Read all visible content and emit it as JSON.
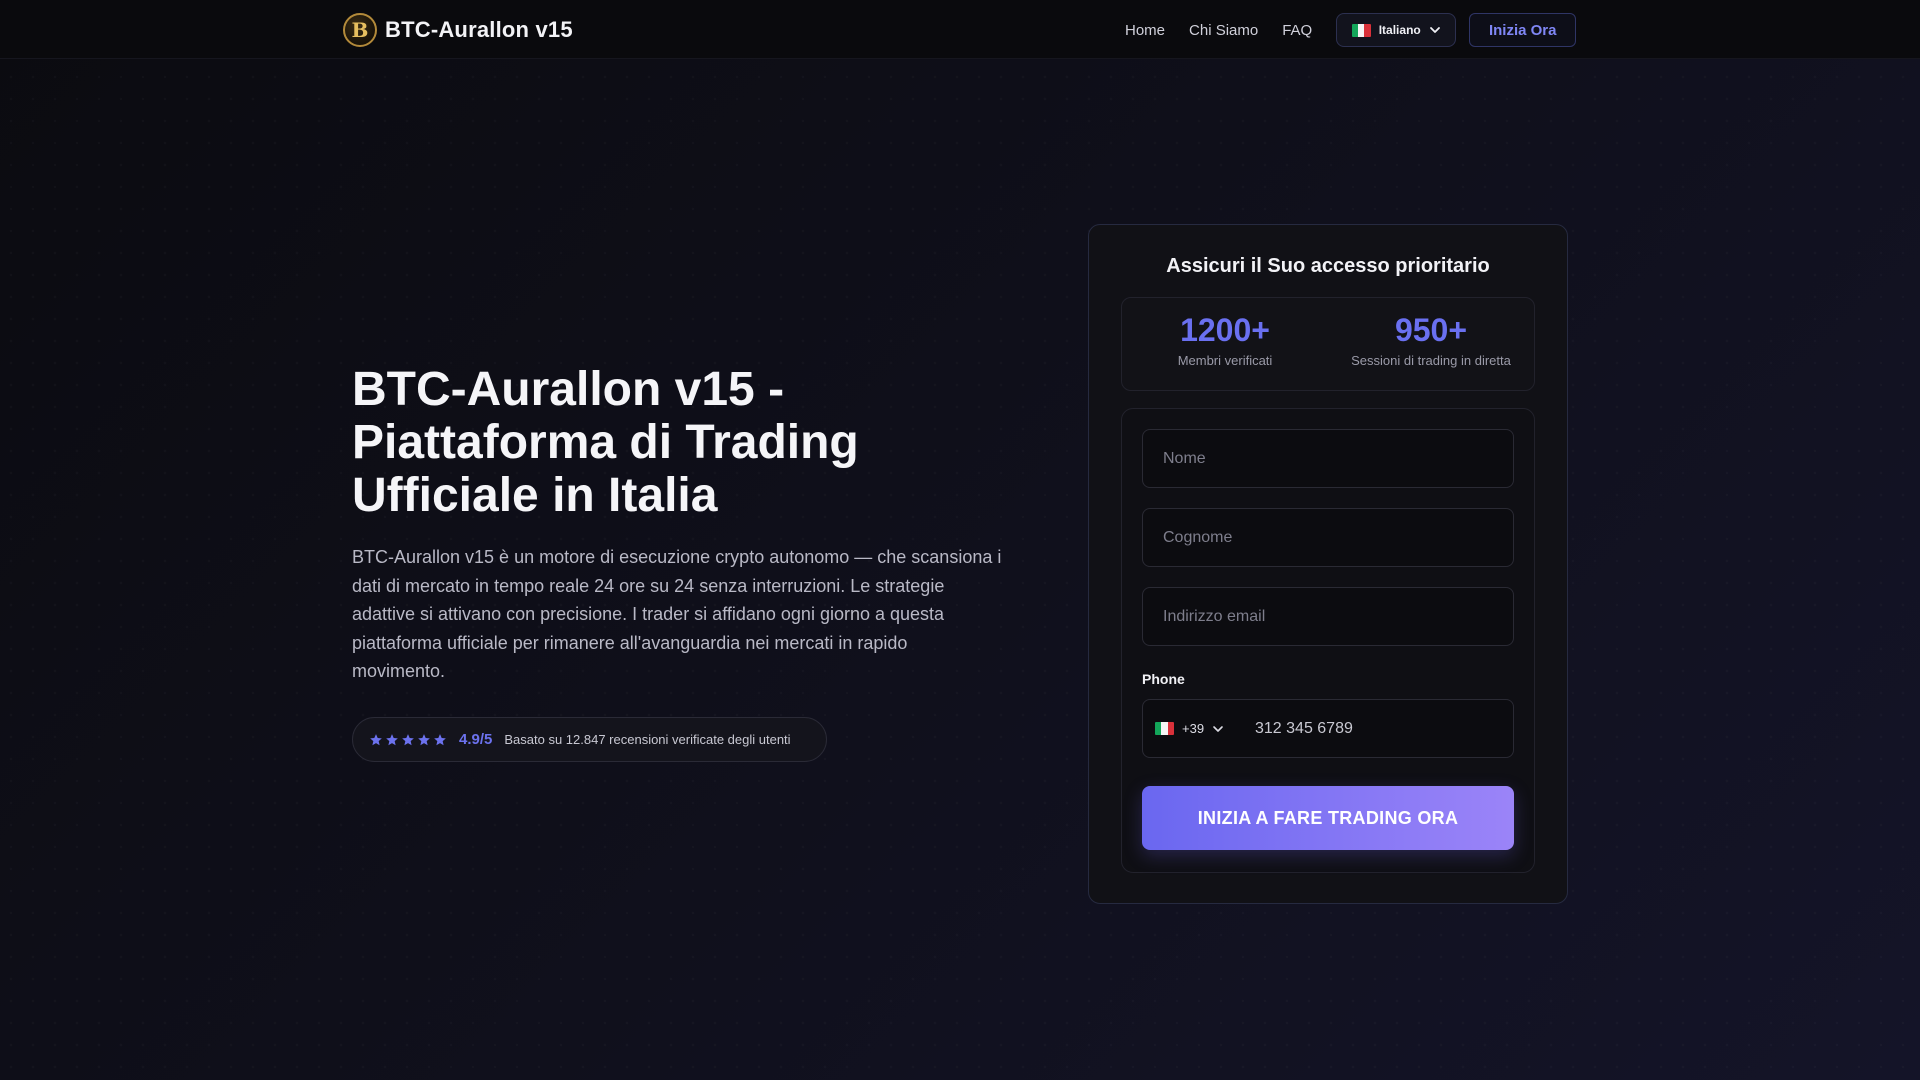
{
  "header": {
    "logo_letter": "B",
    "brand_name": "BTC-Aurallon v15",
    "nav": [
      "Home",
      "Chi Siamo",
      "FAQ"
    ],
    "language": "Italiano",
    "cta": "Inizia Ora"
  },
  "hero": {
    "title": "BTC-Aurallon v15 - Piattaforma di Trading Ufficiale in Italia",
    "description": "BTC-Aurallon v15 è un motore di esecuzione crypto autonomo — che scansiona i dati di mercato in tempo reale 24 ore su 24 senza interruzioni. Le strategie adattive si attivano con precisione. I trader si affidano ogni giorno a questa piattaforma ufficiale per rimanere all'avanguardia nei mercati in rapido movimento.",
    "rating": {
      "stars": 5,
      "score": "4.9/5",
      "text": "Basato su 12.847 recensioni verificate degli utenti"
    }
  },
  "form_card": {
    "title": "Assicuri il Suo accesso prioritario",
    "stats": [
      {
        "value": "1200+",
        "label": "Membri verificati"
      },
      {
        "value": "950+",
        "label": "Sessioni di trading in diretta"
      }
    ],
    "fields": {
      "first_name_placeholder": "Nome",
      "last_name_placeholder": "Cognome",
      "email_placeholder": "Indirizzo email",
      "phone_label": "Phone",
      "country_code": "+39",
      "phone_placeholder": "312 345 6789"
    },
    "submit": "INIZIA A FARE TRADING ORA"
  },
  "colors": {
    "accent": "#6a70f0",
    "button_gradient_start": "#6a67f0",
    "button_gradient_end": "#9b84f8",
    "logo_gold": "#b38a3a"
  },
  "icons": {
    "logo": "bitcoin-coin-logo",
    "language_flag": "italy-flag-icon",
    "dropdown": "chevron-down-icon",
    "rating": "star-icon"
  }
}
